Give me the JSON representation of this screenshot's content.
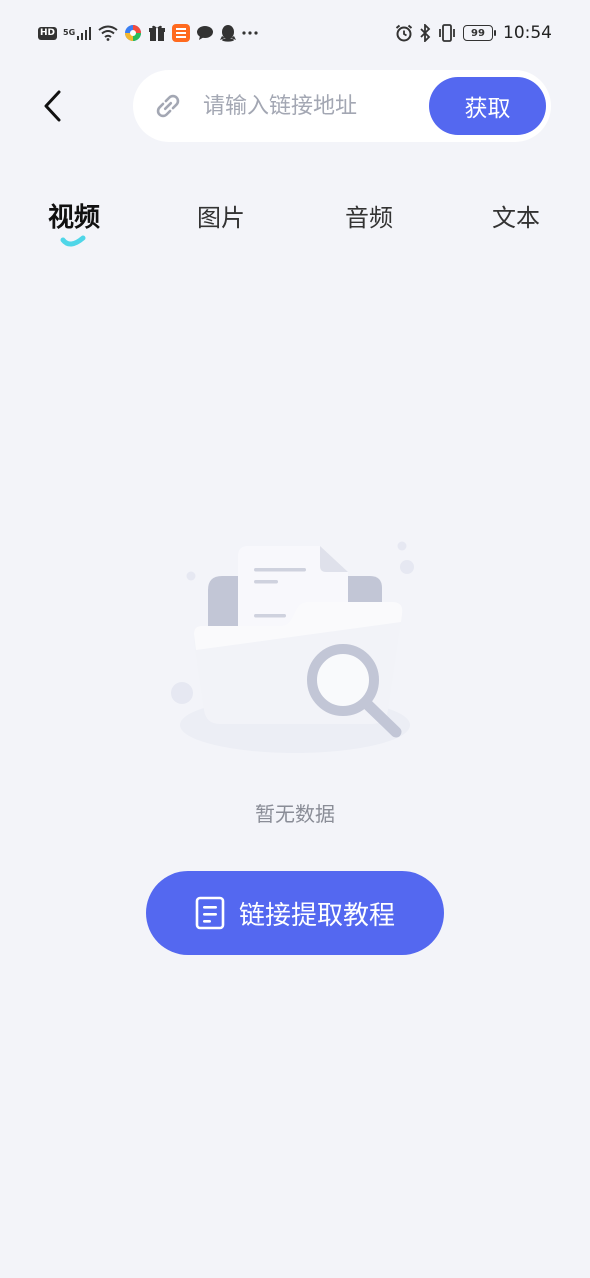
{
  "status_bar": {
    "hd_label": "HD",
    "network_label": "5G",
    "battery_level": "99",
    "time": "10:54",
    "left_icons": [
      "signal-icon",
      "wifi-icon",
      "app-icon-colorful",
      "gift-icon",
      "taobao-icon",
      "chat-bubble-icon",
      "qq-penguin-icon",
      "more-dots-icon"
    ],
    "right_icons": [
      "alarm-icon",
      "bluetooth-icon",
      "vibrate-icon",
      "battery-icon"
    ]
  },
  "header": {
    "back_icon": "chevron-left-icon",
    "search": {
      "placeholder": "请输入链接地址",
      "value": "",
      "icon": "link-icon"
    },
    "fetch_label": "获取"
  },
  "tabs": [
    {
      "label": "视频",
      "active": true
    },
    {
      "label": "图片",
      "active": false
    },
    {
      "label": "音频",
      "active": false
    },
    {
      "label": "文本",
      "active": false
    }
  ],
  "empty_state": {
    "illustration": "empty-folder-search-illustration",
    "message": "暂无数据"
  },
  "tutorial_button": {
    "label": "链接提取教程",
    "icon": "document-icon"
  },
  "colors": {
    "accent": "#5468f0",
    "background": "#f3f4f9",
    "tab_indicator": "#4fd6e8"
  }
}
